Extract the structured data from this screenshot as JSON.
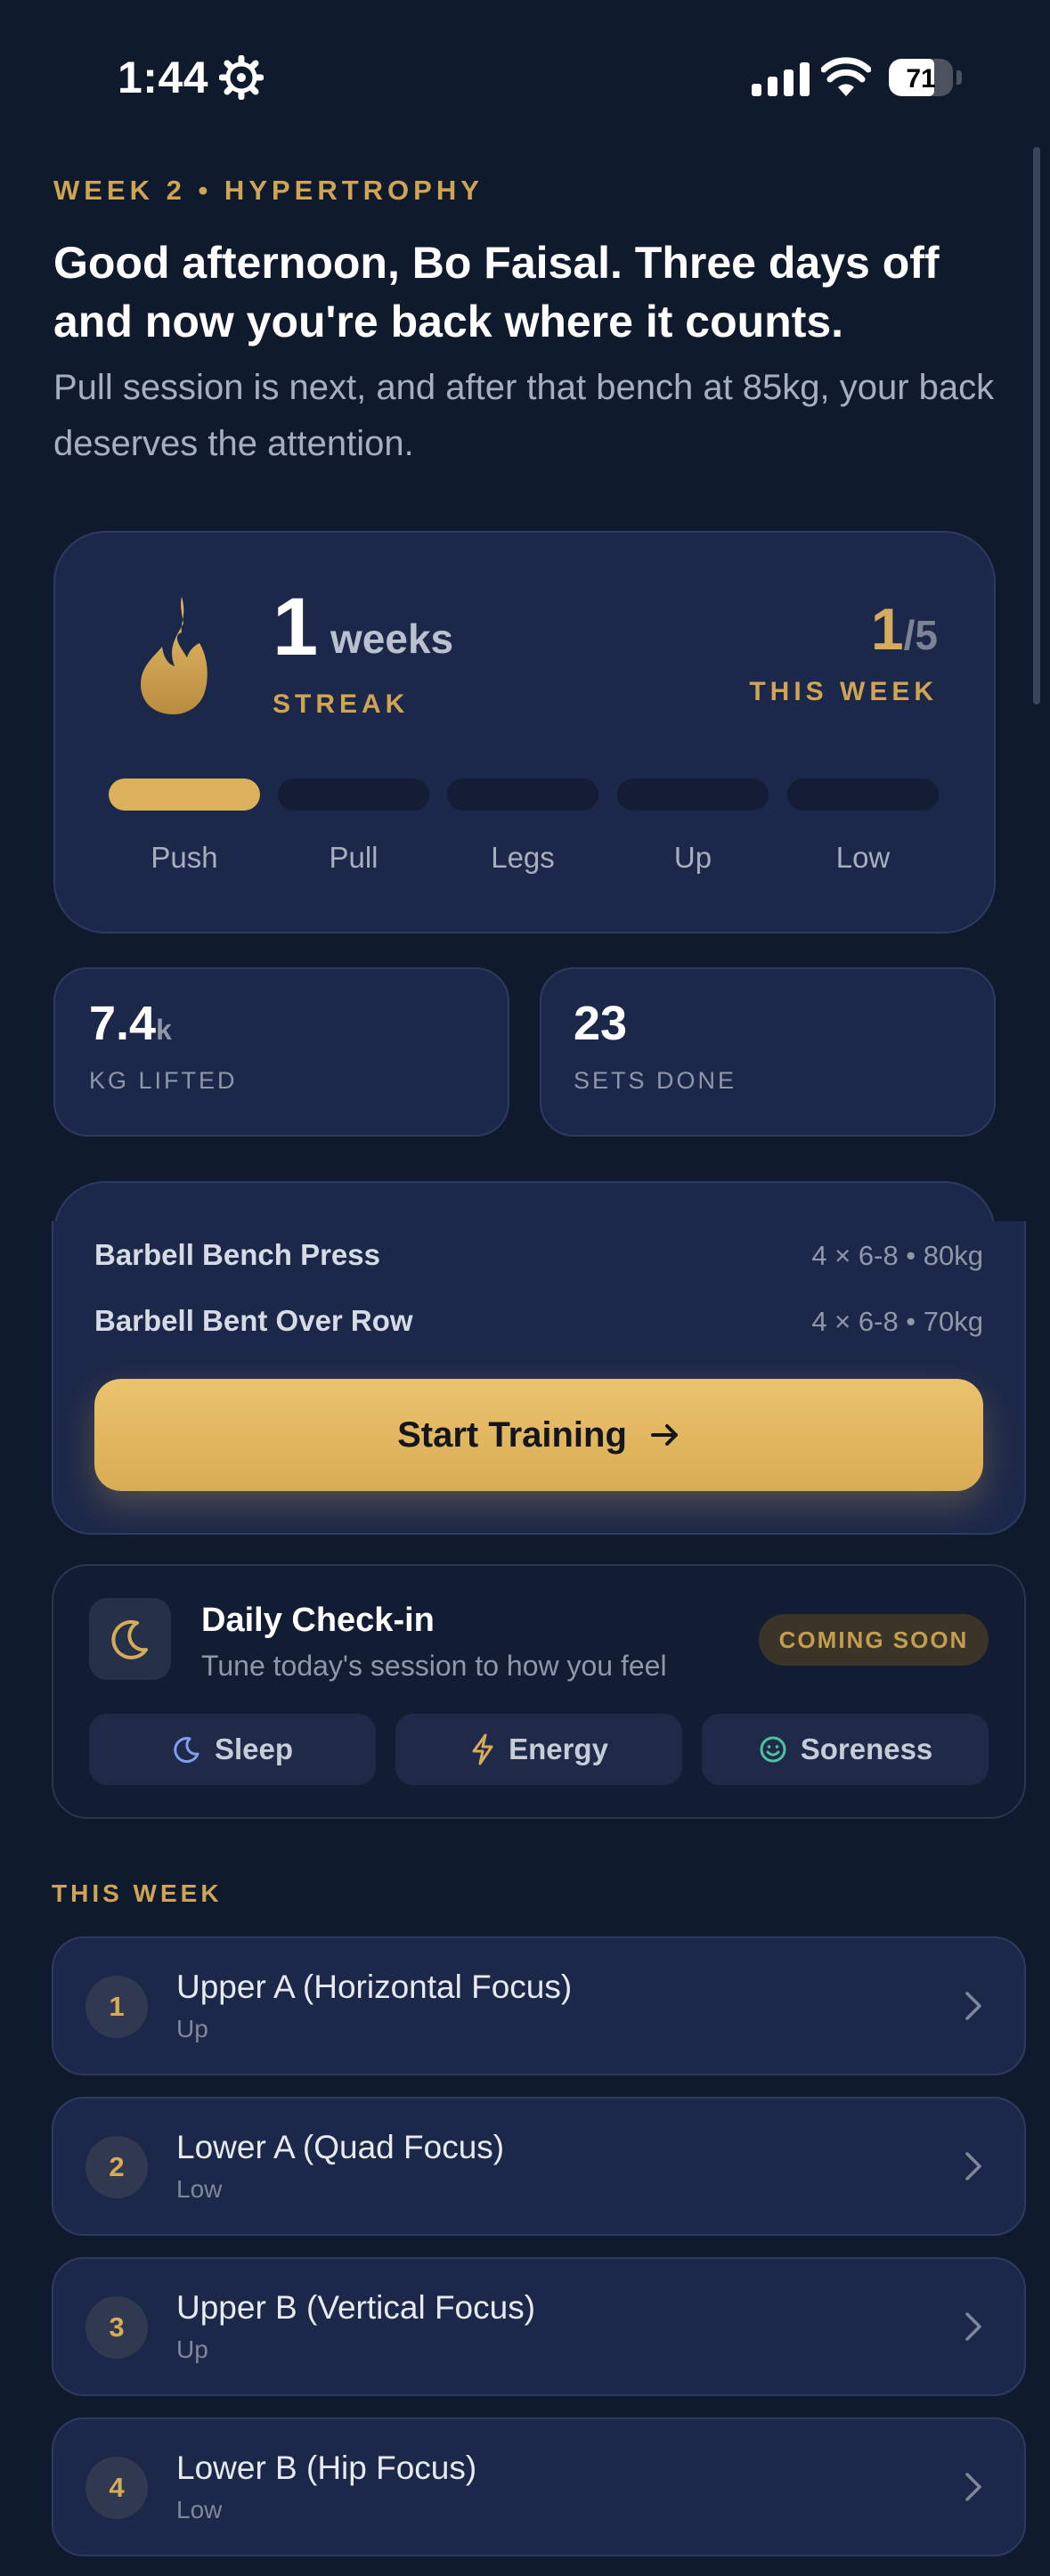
{
  "status_bar": {
    "time": "1:44",
    "battery": "71",
    "battery_level": 0.71
  },
  "header": {
    "eyebrow": "WEEK 2 • HYPERTROPHY",
    "greeting": "Good afternoon, Bo Faisal. Three days off and now you're back where it counts.",
    "subtitle": "Pull session is next, and after that bench at 85kg, your back deserves the attention."
  },
  "streak": {
    "value": "1",
    "unit": "weeks",
    "label": "STREAK",
    "week_done": "1",
    "week_total": "/5",
    "week_label": "THIS WEEK",
    "days": [
      {
        "label": "Push",
        "done": true
      },
      {
        "label": "Pull",
        "done": false
      },
      {
        "label": "Legs",
        "done": false
      },
      {
        "label": "Up",
        "done": false
      },
      {
        "label": "Low",
        "done": false
      }
    ]
  },
  "stats": [
    {
      "value": "7.4",
      "suffix": "k",
      "label": "KG LIFTED"
    },
    {
      "value": "23",
      "suffix": "",
      "label": "SETS DONE"
    }
  ],
  "workout": {
    "exercises": [
      {
        "name": "Barbell Bench Press",
        "meta": "4 × 6-8 • 80kg"
      },
      {
        "name": "Barbell Bent Over Row",
        "meta": "4 × 6-8 • 70kg"
      }
    ],
    "start_label": "Start Training"
  },
  "checkin": {
    "title": "Daily Check-in",
    "subtitle": "Tune today's session to how you feel",
    "badge": "COMING SOON",
    "chips": [
      {
        "label": "Sleep",
        "icon": "moon-icon"
      },
      {
        "label": "Energy",
        "icon": "lightning-icon"
      },
      {
        "label": "Soreness",
        "icon": "smile-icon"
      }
    ]
  },
  "this_week": {
    "label": "THIS WEEK",
    "sessions": [
      {
        "num": "1",
        "title": "Upper A (Horizontal Focus)",
        "sub": "Up"
      },
      {
        "num": "2",
        "title": "Lower A (Quad Focus)",
        "sub": "Low"
      },
      {
        "num": "3",
        "title": "Upper B (Vertical Focus)",
        "sub": "Up"
      },
      {
        "num": "4",
        "title": "Lower B (Hip Focus)",
        "sub": "Low"
      }
    ]
  },
  "colors": {
    "accent": "#d6ac5c",
    "background": "#101a2d",
    "card": "#1c2849"
  }
}
